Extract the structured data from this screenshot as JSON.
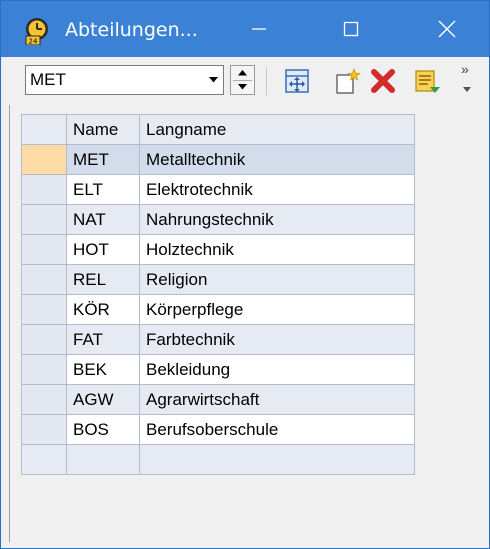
{
  "window": {
    "title": "Abteilungen..."
  },
  "toolbar": {
    "selector_value": "MET",
    "tools": [
      "move-icon",
      "new-record-icon",
      "delete-icon",
      "report-icon"
    ],
    "overflow_label": "»"
  },
  "grid": {
    "columns": [
      "Name",
      "Langname"
    ],
    "rows": [
      {
        "name": "MET",
        "langname": "Metalltechnik"
      },
      {
        "name": "ELT",
        "langname": "Elektrotechnik"
      },
      {
        "name": "NAT",
        "langname": "Nahrungstechnik"
      },
      {
        "name": "HOT",
        "langname": "Holztechnik"
      },
      {
        "name": "REL",
        "langname": "Religion"
      },
      {
        "name": "KÖR",
        "langname": "Körperpflege"
      },
      {
        "name": "FAT",
        "langname": "Farbtechnik"
      },
      {
        "name": "BEK",
        "langname": "Bekleidung"
      },
      {
        "name": "AGW",
        "langname": "Agrarwirtschaft"
      },
      {
        "name": "BOS",
        "langname": "Berufsoberschule"
      }
    ],
    "selected_index": 0
  },
  "colors": {
    "titlebar": "#3b82d6",
    "selected_row": "#d2dcea",
    "row_indicator": "#ffdca5"
  }
}
